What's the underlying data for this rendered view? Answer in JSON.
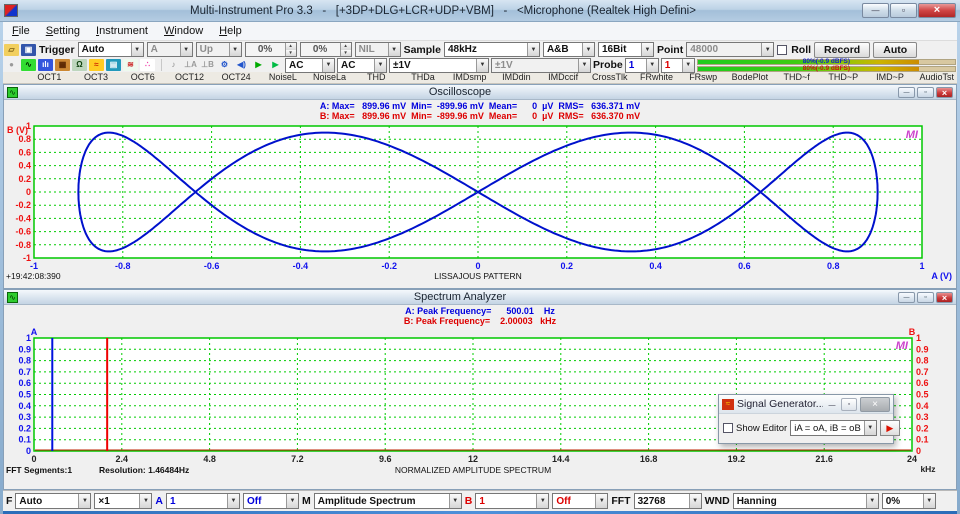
{
  "titlebar": {
    "title": "Multi-Instrument Pro 3.3   -   [+3DP+DLG+LCR+UDP+VBM]   -   <Microphone (Realtek High Defini>"
  },
  "menu": {
    "items": [
      "File",
      "Setting",
      "Instrument",
      "Window",
      "Help"
    ]
  },
  "toolbar1": {
    "icons": [
      {
        "name": "open-icon",
        "glyph": "▱",
        "fg": "#7a5d12",
        "bg": "#f2cf5e"
      },
      {
        "name": "save-icon",
        "glyph": "▣",
        "fg": "#ffffff",
        "bg": "#3355aa"
      }
    ],
    "trigger_label": "Trigger",
    "trigger_mode": "Auto",
    "trigger_source": "A",
    "trigger_edge": "Up",
    "trigger_level": "0%",
    "trigger_delay": "0%",
    "hpf": "NIL",
    "sample_label": "Sample",
    "sample_rate": "48kHz",
    "sampling_channels": "A&B",
    "bit_depth": "16Bit",
    "point_label": "Point",
    "sampling_points": "48000",
    "roll_label": "Roll",
    "record_label": "Record",
    "auto_label": "Auto"
  },
  "toolbar2": {
    "icons": [
      {
        "name": "record-icon",
        "glyph": "●",
        "fg": "#9a9a9a",
        "bg": "#f0f0f0"
      },
      {
        "name": "oscilloscope-icon",
        "glyph": "∿",
        "fg": "#003300",
        "bg": "#33dd33"
      },
      {
        "name": "spectrum-analyzer-icon",
        "glyph": "ılı",
        "fg": "#ffffff",
        "bg": "#3355dd"
      },
      {
        "name": "spectrum-3d-plot-icon",
        "glyph": "▦",
        "fg": "#552200",
        "bg": "#cc8833"
      },
      {
        "name": "multimeter-icon",
        "glyph": "Ω",
        "fg": "#114411",
        "bg": "#bdd6bd"
      },
      {
        "name": "signal-generator-icon",
        "glyph": "≈",
        "fg": "#cc2200",
        "bg": "#ffcc22"
      },
      {
        "name": "device-test-plan-icon",
        "glyph": "▤",
        "fg": "#ffffff",
        "bg": "#2299bb"
      },
      {
        "name": "derived-data-point-icon",
        "glyph": "≋",
        "fg": "#cc2222",
        "bg": "#eefaee"
      },
      {
        "name": "lcr-meter-icon",
        "glyph": "∴",
        "fg": "#ee44aa",
        "bg": "#ffffff"
      },
      {
        "name": "separator"
      },
      {
        "name": "input-device-icon",
        "glyph": "♪",
        "fg": "#8a8a8a",
        "bg": "#f0f0f0"
      },
      {
        "name": "ground-a-icon",
        "glyph": "⊥A",
        "fg": "#999999",
        "bg": "#f0f0f0"
      },
      {
        "name": "ground-b-icon",
        "glyph": "⊥B",
        "fg": "#999999",
        "bg": "#f0f0f0"
      },
      {
        "name": "probe-calibration-icon",
        "glyph": "⚙",
        "fg": "#2255cc",
        "bg": "#f0f0f0"
      },
      {
        "name": "speaker-icon",
        "glyph": "◀)",
        "fg": "#2255cc",
        "bg": "#f0f0f0"
      },
      {
        "name": "run-icon",
        "glyph": "▶",
        "fg": "#00aa00",
        "bg": "#f0f0f0"
      },
      {
        "name": "run-loop-icon",
        "glyph": "▶",
        "fg": "#00bb44",
        "bg": "#f0f0f0"
      }
    ],
    "coupling_a": "AC",
    "coupling_b": "AC",
    "range_a": "±1V",
    "range_b": "±1V",
    "probe_label": "Probe",
    "probe_a": "1",
    "probe_b": "1",
    "meter_a": "80%(-0.9 dBFS)",
    "meter_b": "80%(-0.9 dBFS)"
  },
  "tabs": [
    "OCT1",
    "OCT3",
    "OCT6",
    "OCT12",
    "OCT24",
    "NoiseL",
    "NoiseLa",
    "THD",
    "THDa",
    "IMDsmp",
    "IMDdin",
    "IMDccif",
    "CrossTlk",
    "FRwhite",
    "FRswp",
    "BodePlot",
    "THD~f",
    "THD~P",
    "IMD~P",
    "AudioTst"
  ],
  "oscilloscope": {
    "title": "Oscilloscope",
    "stats_a": "A: Max=   899.96 mV  Min=  -899.96 mV  Mean=      0  µV  RMS=   636.371 mV",
    "stats_b": "B: Max=   899.96 mV  Min=  -899.96 mV  Mean=      0  µV  RMS=   636.370 mV"
  },
  "spectrum": {
    "title": "Spectrum Analyzer",
    "stats_a": "A: Peak Frequency=      500.01    Hz",
    "stats_b": "B: Peak Frequency=    2.00003   kHz"
  },
  "signal_generator": {
    "title": "Signal Generator...",
    "show_editor_label": "Show Editor",
    "routing": "iA = oA, iB = oB"
  },
  "bottombar": {
    "f_label": "F",
    "freq_axis_mode": "Auto",
    "x_zoom": "×1",
    "a_label": "A",
    "a_gain": "1",
    "a_mode": "Off",
    "m_label": "M",
    "display_mode": "Amplitude Spectrum",
    "b_label": "B",
    "b_gain": "1",
    "b_mode": "Off",
    "fft_label": "FFT",
    "fft_size": "32768",
    "wnd_label": "WND",
    "window_function": "Hanning",
    "overlap": "0%"
  },
  "chart_data": [
    {
      "id": "oscilloscope",
      "type": "line",
      "mode": "lissajous-xy",
      "title": "LISSAJOUS PATTERN",
      "timestamp_label": "+19:42:08:390",
      "logo": "MI",
      "x_axis": {
        "label": "A (V)",
        "min": -1,
        "max": 1,
        "ticks": [
          -1,
          -0.8,
          -0.6,
          -0.4,
          -0.2,
          0,
          0.2,
          0.4,
          0.6,
          0.8,
          1
        ],
        "tick_color": "#1111ee"
      },
      "y_axis": {
        "label": "B (V)",
        "min": -1,
        "max": 1,
        "ticks": [
          1,
          0.8,
          0.6,
          0.4,
          0.2,
          0,
          -0.2,
          -0.4,
          -0.6,
          -0.8,
          -1
        ],
        "tick_color": "#ee1111"
      },
      "grid": {
        "on": true,
        "color": "#00cc00",
        "style": "dashed"
      },
      "curve": {
        "description": "x = 0.9·sin(2π·500.01·t), y = 0.9·sin(2π·2000.03·t)",
        "amplitude_x": 0.9,
        "amplitude_y": 0.9,
        "freq_x_hz": 500.01,
        "freq_y_hz": 2000.03,
        "freq_ratio": 4,
        "phase_deg": 0,
        "color": "#0011cc"
      }
    },
    {
      "id": "spectrum-analyzer",
      "type": "bar",
      "title": "NORMALIZED AMPLITUDE SPECTRUM",
      "logo": "MI",
      "footer": {
        "segments": "FFT Segments:1",
        "resolution": "Resolution: 1.46484Hz"
      },
      "x_axis": {
        "unit": "kHz",
        "min": 0,
        "max": 24,
        "ticks": [
          0,
          2.4,
          4.8,
          7.2,
          9.6,
          12,
          14.4,
          16.8,
          19.2,
          21.6,
          24
        ],
        "tick_color": "#222222"
      },
      "y_axis_left": {
        "label": "A",
        "color": "#1111ee",
        "min": 0,
        "max": 1,
        "ticks": [
          1,
          0.9,
          0.8,
          0.7,
          0.6,
          0.5,
          0.4,
          0.3,
          0.2,
          0.1,
          0
        ]
      },
      "y_axis_right": {
        "label": "B",
        "color": "#ee1111",
        "min": 0,
        "max": 1,
        "ticks": [
          1,
          0.9,
          0.8,
          0.7,
          0.6,
          0.5,
          0.4,
          0.3,
          0.2,
          0.1,
          0
        ]
      },
      "grid": {
        "on": true,
        "color": "#00cc00",
        "style": "dashed"
      },
      "series": [
        {
          "name": "A",
          "color": "#0011dd",
          "peaks": [
            {
              "freq_khz": 0.50001,
              "amplitude": 1.0
            }
          ]
        },
        {
          "name": "B",
          "color": "#ee0000",
          "peaks": [
            {
              "freq_khz": 2.00003,
              "amplitude": 1.0
            }
          ]
        }
      ]
    }
  ]
}
